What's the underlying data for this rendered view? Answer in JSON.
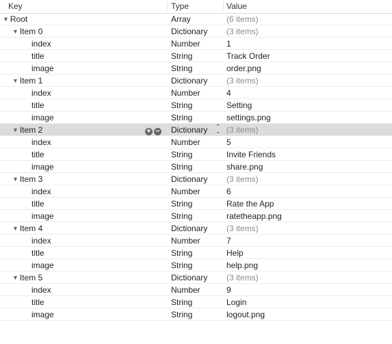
{
  "columns": {
    "key": "Key",
    "type": "Type",
    "value": "Value"
  },
  "rows": [
    {
      "key": "Root",
      "level": 0,
      "expandable": true,
      "type": "Array",
      "value": "(6 items)",
      "muted": true
    },
    {
      "key": "Item 0",
      "level": 1,
      "expandable": true,
      "type": "Dictionary",
      "value": "(3 items)",
      "muted": true
    },
    {
      "key": "index",
      "level": 2,
      "type": "Number",
      "value": "1"
    },
    {
      "key": "title",
      "level": 2,
      "type": "String",
      "value": "Track Order"
    },
    {
      "key": "image",
      "level": 2,
      "type": "String",
      "value": "order.png"
    },
    {
      "key": "Item 1",
      "level": 1,
      "expandable": true,
      "type": "Dictionary",
      "value": "(3 items)",
      "muted": true
    },
    {
      "key": "index",
      "level": 2,
      "type": "Number",
      "value": "4"
    },
    {
      "key": "title",
      "level": 2,
      "type": "String",
      "value": "Setting"
    },
    {
      "key": "image",
      "level": 2,
      "type": "String",
      "value": "settings.png"
    },
    {
      "key": "Item 2",
      "level": 1,
      "expandable": true,
      "type": "Dictionary",
      "value": "(3 items)",
      "muted": true,
      "selected": true
    },
    {
      "key": "index",
      "level": 2,
      "type": "Number",
      "value": "5"
    },
    {
      "key": "title",
      "level": 2,
      "type": "String",
      "value": "Invite Friends"
    },
    {
      "key": "image",
      "level": 2,
      "type": "String",
      "value": "share.png"
    },
    {
      "key": "Item 3",
      "level": 1,
      "expandable": true,
      "type": "Dictionary",
      "value": "(3 items)",
      "muted": true
    },
    {
      "key": "index",
      "level": 2,
      "type": "Number",
      "value": "6"
    },
    {
      "key": "title",
      "level": 2,
      "type": "String",
      "value": "Rate the App"
    },
    {
      "key": "image",
      "level": 2,
      "type": "String",
      "value": "ratetheapp.png"
    },
    {
      "key": "Item 4",
      "level": 1,
      "expandable": true,
      "type": "Dictionary",
      "value": "(3 items)",
      "muted": true
    },
    {
      "key": "index",
      "level": 2,
      "type": "Number",
      "value": "7"
    },
    {
      "key": "title",
      "level": 2,
      "type": "String",
      "value": "Help"
    },
    {
      "key": "image",
      "level": 2,
      "type": "String",
      "value": "help.png"
    },
    {
      "key": "Item 5",
      "level": 1,
      "expandable": true,
      "type": "Dictionary",
      "value": "(3 items)",
      "muted": true
    },
    {
      "key": "index",
      "level": 2,
      "type": "Number",
      "value": "9"
    },
    {
      "key": "title",
      "level": 2,
      "type": "String",
      "value": "Login"
    },
    {
      "key": "image",
      "level": 2,
      "type": "String",
      "value": "logout.png"
    }
  ],
  "icons": {
    "expanded": "disclosure-triangle-down-icon",
    "add": "plus-circle-icon",
    "remove": "minus-circle-icon",
    "stepper": "up-down-chevron-icon"
  }
}
